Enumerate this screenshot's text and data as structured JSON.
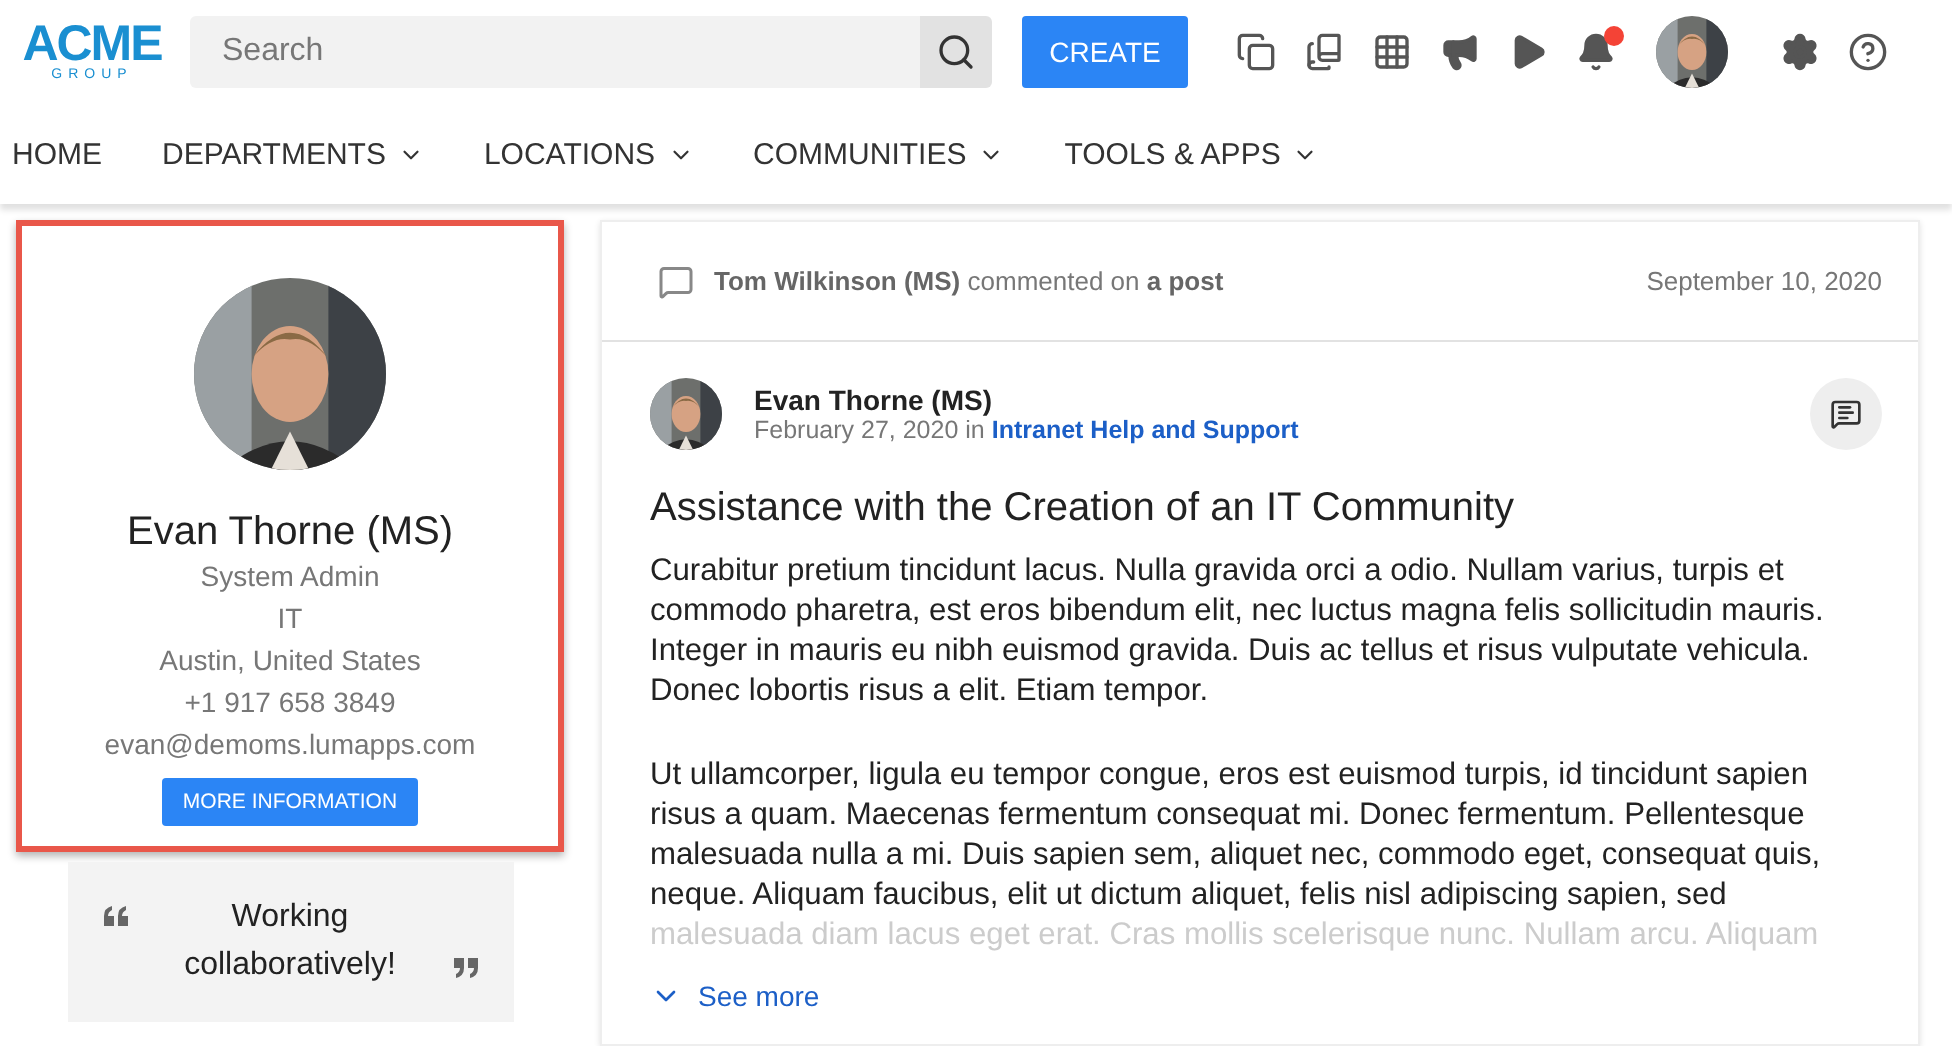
{
  "logo": {
    "name": "ACME",
    "tagline": "GROUP"
  },
  "search": {
    "placeholder": "Search"
  },
  "create_button": "CREATE",
  "toolbar": {
    "notifications_unread": true
  },
  "nav": [
    {
      "label": "HOME",
      "has_menu": false
    },
    {
      "label": "DEPARTMENTS",
      "has_menu": true
    },
    {
      "label": "LOCATIONS",
      "has_menu": true
    },
    {
      "label": "COMMUNITIES",
      "has_menu": true
    },
    {
      "label": "TOOLS & APPS",
      "has_menu": true
    }
  ],
  "profile": {
    "highlighted": true,
    "name": "Evan Thorne (MS)",
    "details": [
      "System Admin",
      "IT",
      "Austin, United States",
      "+1 917 658 3849",
      "evan@demoms.lumapps.com"
    ],
    "button": "MORE INFORMATION"
  },
  "quote": {
    "text": "Working collaboratively!"
  },
  "activity": {
    "actor": "Tom Wilkinson (MS)",
    "action": "commented on",
    "target": "a post",
    "date": "September 10, 2020"
  },
  "post": {
    "author": "Evan Thorne (MS)",
    "date": "February 27, 2020",
    "in": "in",
    "community": "Intranet Help and Support",
    "title": "Assistance with the Creation of an IT Community",
    "paragraphs": [
      "Curabitur pretium tincidunt lacus. Nulla gravida orci a odio. Nullam varius, turpis et commodo pharetra, est eros bibendum elit, nec luctus magna felis sollicitudin mauris. Integer in mauris eu nibh euismod gravida. Duis ac tellus et risus vulputate vehicula. Donec lobortis risus a elit. Etiam tempor.",
      "Ut ullamcorper, ligula eu tempor congue, eros est euismod turpis, id tincidunt sapien risus a quam. Maecenas fermentum consequat mi. Donec fermentum. Pellentesque malesuada nulla a mi. Duis sapien sem, aliquet nec, commodo eget, consequat quis, neque. Aliquam faucibus, elit ut dictum aliquet, felis nisl adipiscing sapien, sed"
    ],
    "faded_line": "malesuada diam lacus eget erat. Cras mollis scelerisque nunc. Nullam arcu. Aliquam",
    "see_more": "See more"
  }
}
